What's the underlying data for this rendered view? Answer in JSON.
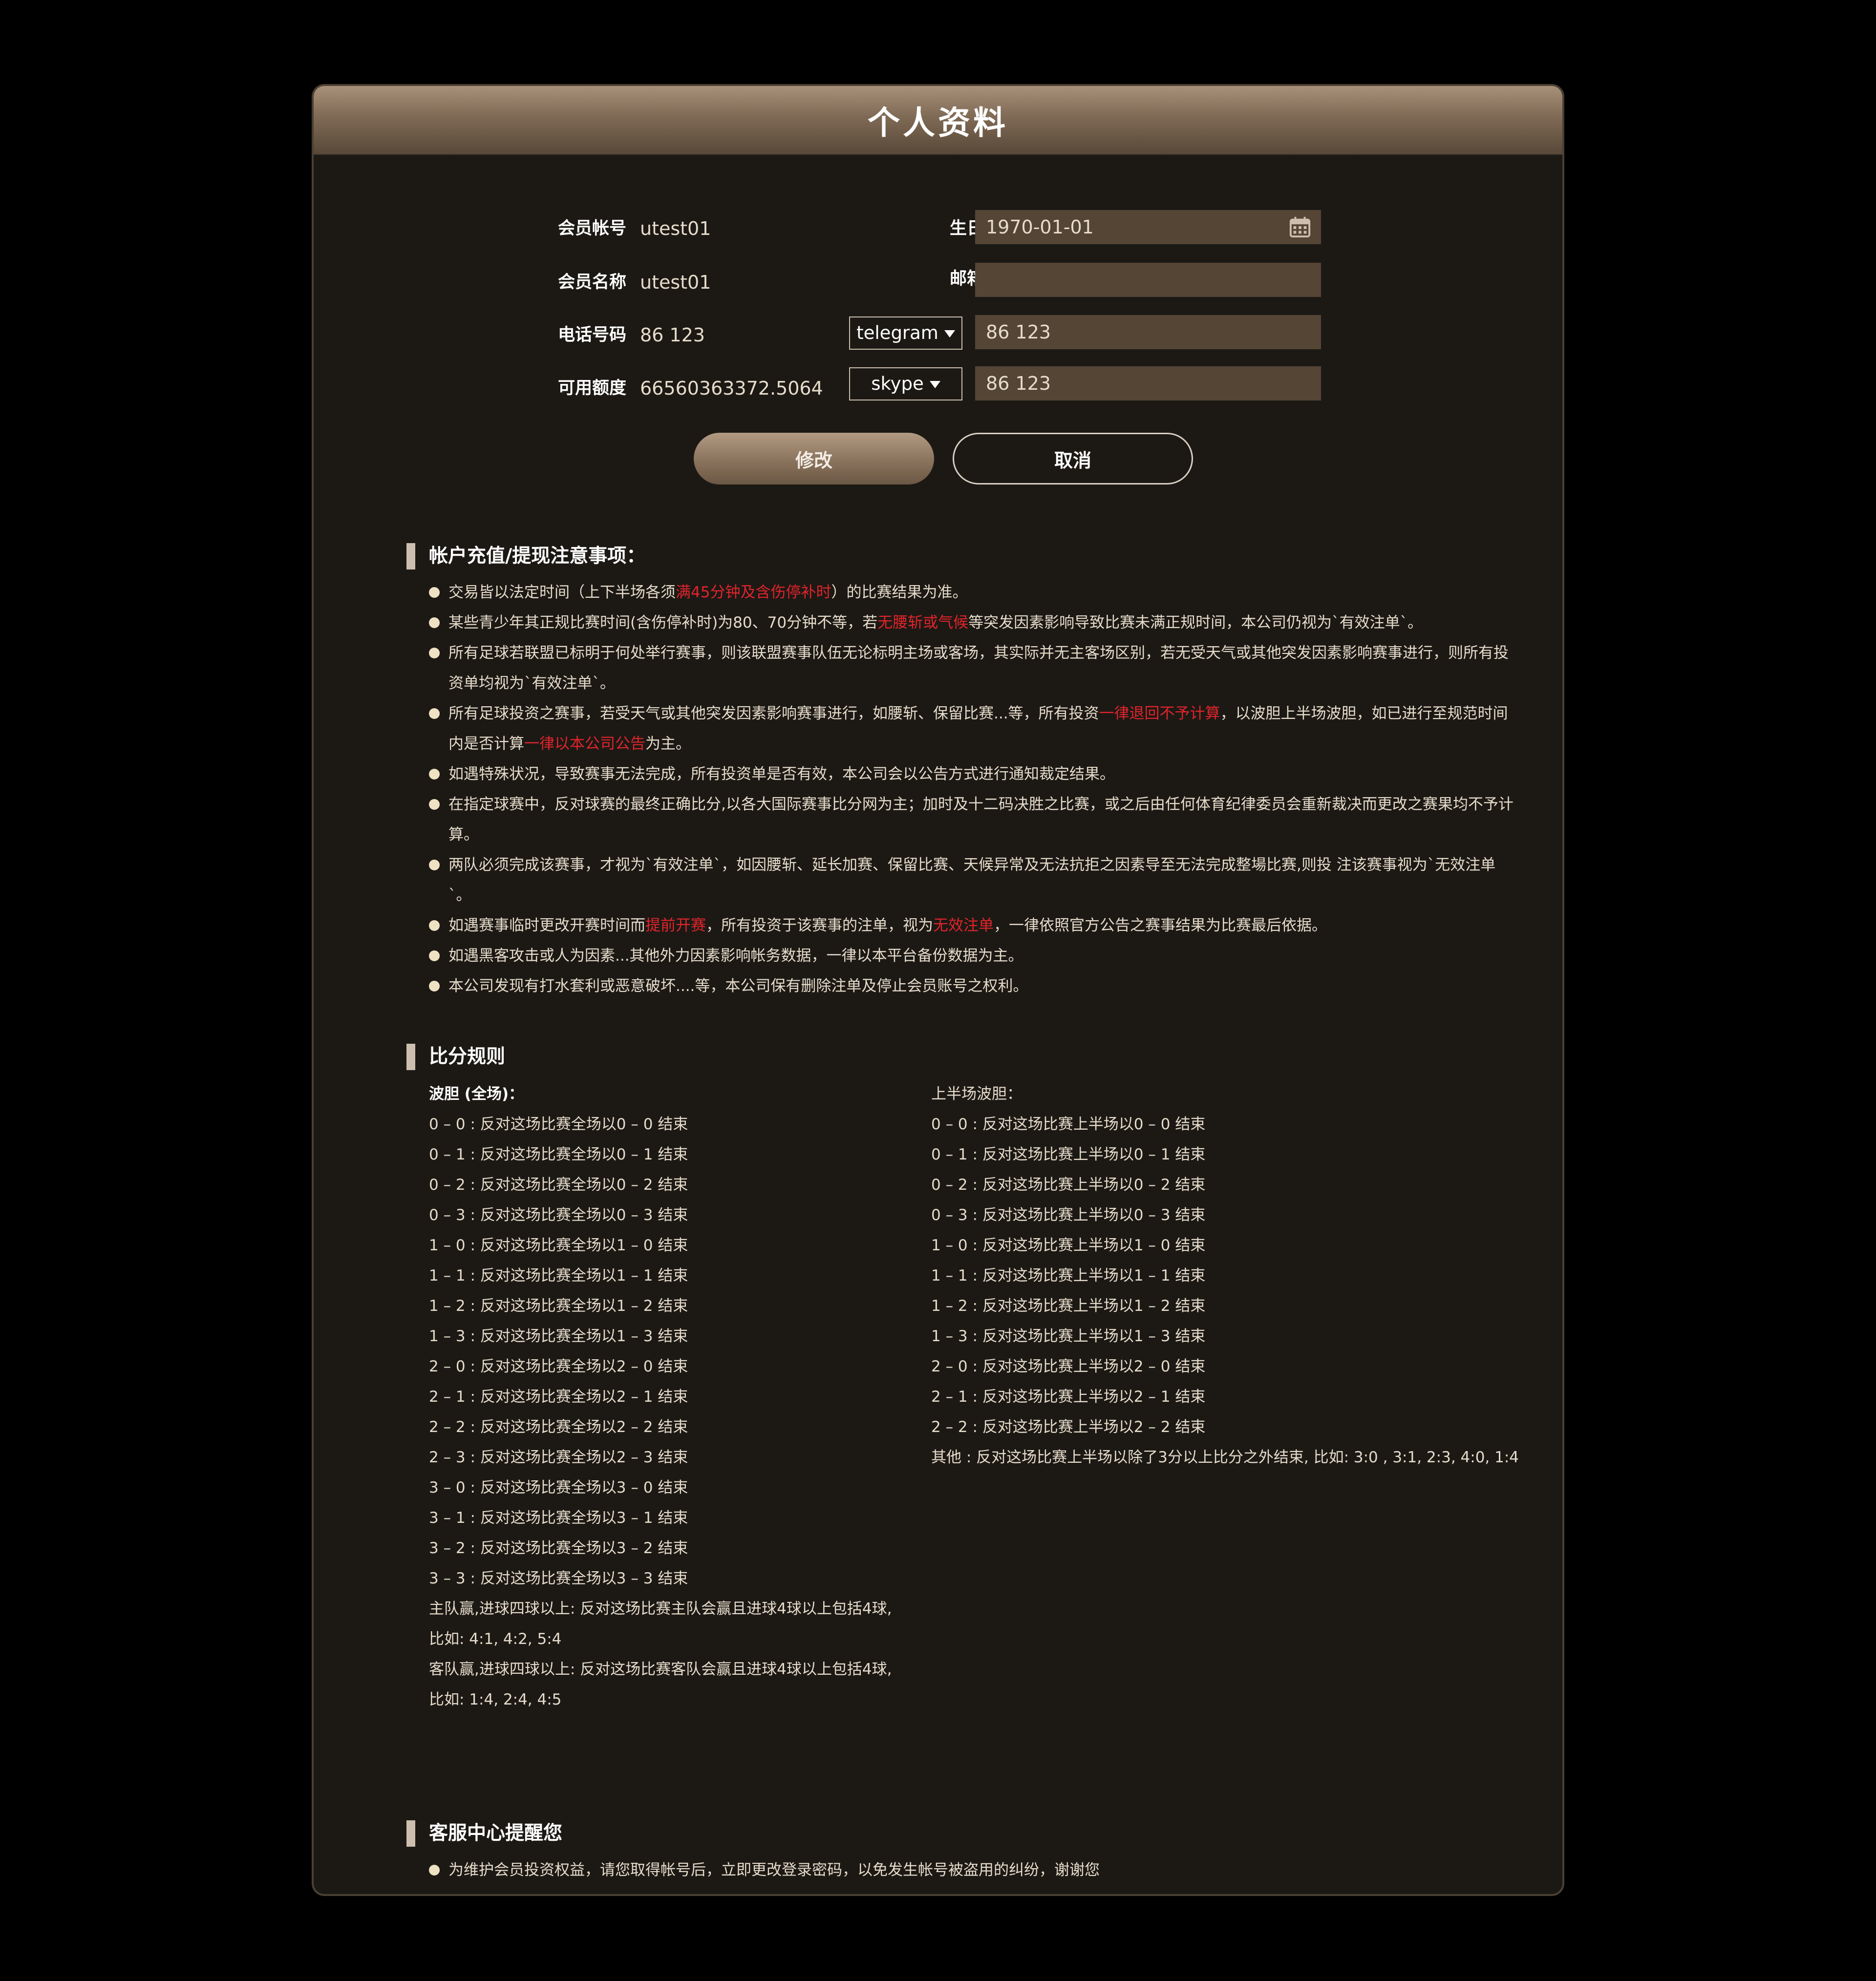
{
  "title": "个人资料",
  "profile": {
    "account_label": "会员帐号",
    "account_value": "utest01",
    "name_label": "会员名称",
    "name_value": "utest01",
    "phone_label": "电话号码",
    "phone_value": "86 123",
    "credit_label": "可用额度",
    "credit_value": "66560363372.5064",
    "birthday_label": "生日",
    "birthday_value": "1970-01-01",
    "email_label": "邮箱",
    "email_value": "",
    "contact1_type": "telegram",
    "contact1_value": "86 123",
    "contact2_type": "skype",
    "contact2_value": "86 123"
  },
  "buttons": {
    "modify": "修改",
    "cancel": "取消"
  },
  "notes_section": {
    "title": "帐户充值/提现注意事项：",
    "items": [
      [
        {
          "t": "交易皆以法定时间（上下半场各须"
        },
        {
          "t": "满45分钟及含伤停补时",
          "red": true
        },
        {
          "t": "）的比赛结果为准。"
        }
      ],
      [
        {
          "t": "某些青少年其正规比赛时间(含伤停补时)为80、70分钟不等，若"
        },
        {
          "t": "无腰斩或气候",
          "red": true
        },
        {
          "t": "等突发因素影响导致比赛未满正规时间，本公司仍视为`有效注单`。"
        }
      ],
      [
        {
          "t": "所有足球若联盟已标明于何处举行赛事，则该联盟赛事队伍无论标明主场或客场，其实际并无主客场区别，若无受天气或其他突发因素影响赛事进行，则所有投资单均视为`有效注单`。"
        }
      ],
      [
        {
          "t": "所有足球投资之赛事，若受天气或其他突发因素影响赛事进行，如腰斩、保留比赛...等，所有投资"
        },
        {
          "t": "一律退回不予计算",
          "red": true
        },
        {
          "t": "，以波胆上半场波胆，如已进行至规范时间内是否计算"
        },
        {
          "t": "一律以本公司公告",
          "red": true
        },
        {
          "t": "为主。"
        }
      ],
      [
        {
          "t": "如遇特殊状况，导致赛事无法完成，所有投资单是否有效，本公司会以公告方式进行通知裁定结果。"
        }
      ],
      [
        {
          "t": "在指定球赛中，反对球赛的最终正确比分,以各大国际赛事比分网为主；加时及十二码决胜之比赛，或之后由任何体育纪律委员会重新裁决而更改之赛果均不予计算。"
        }
      ],
      [
        {
          "t": "两队必须完成该赛事，才视为`有效注单`，如因腰斩、延长加赛、保留比赛、天候异常及无法抗拒之因素导至无法完成整場比赛,则投 注该赛事视为`无效注单`。"
        }
      ],
      [
        {
          "t": "如遇赛事临时更改开赛时间而"
        },
        {
          "t": "提前开赛",
          "red": true
        },
        {
          "t": "，所有投资于该赛事的注单，视为"
        },
        {
          "t": "无效注单",
          "red": true
        },
        {
          "t": "，一律依照官方公告之赛事结果为比赛最后依据。"
        }
      ],
      [
        {
          "t": "如遇黑客攻击或人为因素...其他外力因素影响帐务数据，一律以本平台备份数据为主。"
        }
      ],
      [
        {
          "t": "本公司发现有打水套利或恶意破坏....等，本公司保有删除注单及停止会员账号之权利。"
        }
      ]
    ]
  },
  "score_section": {
    "title": "比分规则",
    "full_title": "波胆 (全场)：",
    "full_lines": [
      "0 – 0 : 反对这场比赛全场以0 – 0 结束",
      "0 – 1 : 反对这场比赛全场以0 – 1 结束",
      "0 – 2 : 反对这场比赛全场以0 – 2 结束",
      "0 – 3 : 反对这场比赛全场以0 – 3 结束",
      "1 – 0 : 反对这场比赛全场以1 – 0 结束",
      "1 – 1 : 反对这场比赛全场以1 – 1 结束",
      "1 – 2 : 反对这场比赛全场以1 – 2 结束",
      "1 – 3 : 反对这场比赛全场以1 – 3 结束",
      "2 – 0 : 反对这场比赛全场以2 – 0 结束",
      "2 – 1 : 反对这场比赛全场以2 – 1 结束",
      "2 – 2 : 反对这场比赛全场以2 – 2 结束",
      "2 – 3 : 反对这场比赛全场以2 – 3 结束",
      "3 – 0 : 反对这场比赛全场以3 – 0 结束",
      "3 – 1 : 反对这场比赛全场以3 – 1 结束",
      "3 – 2 : 反对这场比赛全场以3 – 2 结束",
      "3 – 3 : 反对这场比赛全场以3 – 3 结束",
      "主队赢,进球四球以上: 反对这场比赛主队会赢且进球4球以上包括4球,",
      "比如: 4:1, 4:2, 5:4",
      "客队赢,进球四球以上: 反对这场比赛客队会赢且进球4球以上包括4球,",
      "比如: 1:4, 2:4, 4:5"
    ],
    "half_title": "上半场波胆：",
    "half_lines": [
      "0 – 0 : 反对这场比赛上半场以0 – 0 结束",
      "0 – 1 : 反对这场比赛上半场以0 – 1 结束",
      "0 – 2 : 反对这场比赛上半场以0 – 2 结束",
      "0 – 3 : 反对这场比赛上半场以0 – 3 结束",
      "1 – 0 : 反对这场比赛上半场以1 – 0 结束",
      "1 – 1 : 反对这场比赛上半场以1 – 1 结束",
      "1 – 2 : 反对这场比赛上半场以1 – 2 结束",
      "1 – 3 : 反对这场比赛上半场以1 – 3 结束",
      "2 – 0 : 反对这场比赛上半场以2 – 0 结束",
      "2 – 1 : 反对这场比赛上半场以2 – 1 结束",
      "2 – 2 : 反对这场比赛上半场以2 – 2 结束",
      "其他 : 反对这场比赛上半场以除了3分以上比分之外结束, 比如: 3:0 , 3:1, 2:3, 4:0, 1:4"
    ]
  },
  "service_section": {
    "title": "客服中心提醒您",
    "items": [
      "为维护会员投资权益，请您取得帐号后，立即更改登录密码，以免发生帐号被盗用的纠纷，谢谢您"
    ]
  },
  "icons": {
    "calendar": "calendar-icon",
    "dropdown": "chevron-down-icon"
  },
  "colors": {
    "header_gradient_top": "#a8917a",
    "header_gradient_bottom": "#584838",
    "panel_bg": "#1c1915",
    "input_bg": "#554535",
    "highlight_red": "#e0242b"
  }
}
